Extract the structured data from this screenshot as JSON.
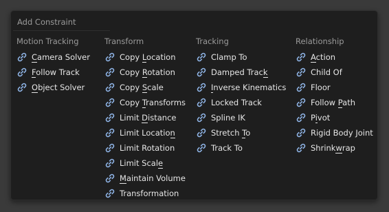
{
  "menu": {
    "title": "Add Constraint"
  },
  "columns": [
    {
      "header": "Motion Tracking",
      "items": [
        {
          "pre": "",
          "ul": "C",
          "post": "amera Solver"
        },
        {
          "pre": "",
          "ul": "F",
          "post": "ollow Track"
        },
        {
          "pre": "",
          "ul": "O",
          "post": "bject Solver"
        }
      ]
    },
    {
      "header": "Transform",
      "items": [
        {
          "pre": "Copy ",
          "ul": "L",
          "post": "ocation"
        },
        {
          "pre": "Copy ",
          "ul": "R",
          "post": "otation"
        },
        {
          "pre": "Copy ",
          "ul": "S",
          "post": "cale"
        },
        {
          "pre": "Copy ",
          "ul": "T",
          "post": "ransforms"
        },
        {
          "pre": "Limit ",
          "ul": "D",
          "post": "istance"
        },
        {
          "pre": "Limit Locatio",
          "ul": "n",
          "post": ""
        },
        {
          "pre": "Limit Rotation",
          "ul": "",
          "post": ""
        },
        {
          "pre": "Limit Scal",
          "ul": "e",
          "post": ""
        },
        {
          "pre": "",
          "ul": "M",
          "post": "aintain Volume"
        },
        {
          "pre": "Transformation",
          "ul": "",
          "post": ""
        }
      ]
    },
    {
      "header": "Tracking",
      "items": [
        {
          "pre": "Clamp To",
          "ul": "",
          "post": ""
        },
        {
          "pre": "Damped Trac",
          "ul": "k",
          "post": ""
        },
        {
          "pre": "",
          "ul": "I",
          "post": "nverse Kinematics"
        },
        {
          "pre": "Locked Track",
          "ul": "",
          "post": ""
        },
        {
          "pre": "Spline IK",
          "ul": "",
          "post": ""
        },
        {
          "pre": "Stretch ",
          "ul": "T",
          "post": "o"
        },
        {
          "pre": "Track To",
          "ul": "",
          "post": ""
        }
      ]
    },
    {
      "header": "Relationship",
      "items": [
        {
          "pre": "",
          "ul": "A",
          "post": "ction"
        },
        {
          "pre": "Child Of",
          "ul": "",
          "post": ""
        },
        {
          "pre": "Floor",
          "ul": "",
          "post": ""
        },
        {
          "pre": "Follow ",
          "ul": "P",
          "post": "ath"
        },
        {
          "pre": "P",
          "ul": "i",
          "post": "vot"
        },
        {
          "pre": "Rigid Body Joint",
          "ul": "",
          "post": ""
        },
        {
          "pre": "Shrink",
          "ul": "w",
          "post": "rap"
        }
      ]
    }
  ],
  "icon": "constraint-link-icon",
  "colors": {
    "menu_bg": "#1e1e1e",
    "text": "#e6e6e6",
    "header_text": "#9a9a9a",
    "icon_blue": "#8fb4e6"
  }
}
